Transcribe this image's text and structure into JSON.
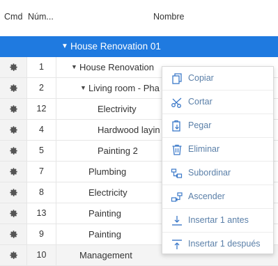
{
  "header": {
    "cmd": "Cmd",
    "num": "Núm...",
    "name": "Nombre"
  },
  "group": {
    "label": "House Renovation 01"
  },
  "rows": [
    {
      "num": "1",
      "name": "House Renovation"
    },
    {
      "num": "2",
      "name": "Living room - Pha"
    },
    {
      "num": "12",
      "name": "Electrivity"
    },
    {
      "num": "4",
      "name": "Hardwood layin"
    },
    {
      "num": "5",
      "name": "Painting 2"
    },
    {
      "num": "7",
      "name": "Plumbing"
    },
    {
      "num": "8",
      "name": "Electricity"
    },
    {
      "num": "13",
      "name": "Painting"
    },
    {
      "num": "9",
      "name": "Painting"
    },
    {
      "num": "10",
      "name": "Management"
    }
  ],
  "menu": {
    "copy": "Copiar",
    "cut": "Cortar",
    "paste": "Pegar",
    "delete": "Eliminar",
    "indent": "Subordinar",
    "outdent": "Ascender",
    "insert_before": "Insertar 1 antes",
    "insert_after": "Insertar 1 después"
  },
  "colors": {
    "accent": "#1f7ae0",
    "menu_text": "#5a7fa8",
    "icon": "#3a78c8"
  }
}
